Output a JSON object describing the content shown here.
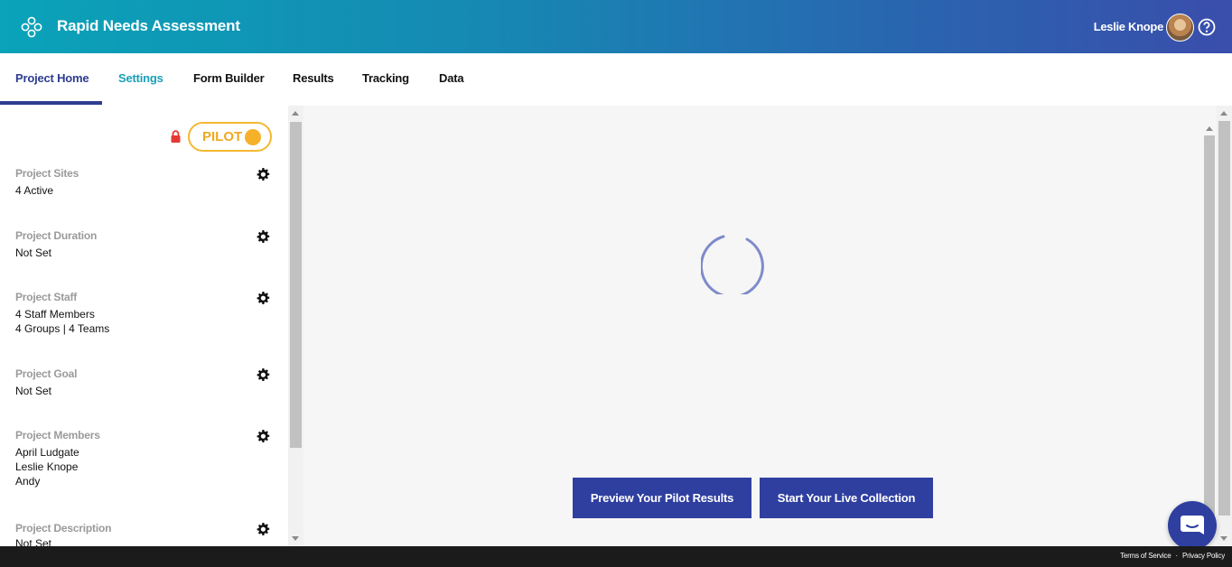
{
  "header": {
    "app_title": "Rapid Needs Assessment",
    "user_name": "Leslie Knope"
  },
  "tabs": [
    {
      "label": "Project Home",
      "active": true
    },
    {
      "label": "Settings",
      "active": false
    },
    {
      "label": "Form Builder",
      "active": false
    },
    {
      "label": "Results",
      "active": false
    },
    {
      "label": "Tracking",
      "active": false
    },
    {
      "label": "Data",
      "active": false
    }
  ],
  "status": {
    "badge_label": "PILOT",
    "locked": true
  },
  "sections": [
    {
      "label": "Project Sites",
      "values": [
        "4 Active"
      ]
    },
    {
      "label": "Project Duration",
      "values": [
        "Not Set"
      ]
    },
    {
      "label": "Project Staff",
      "values": [
        "4 Staff Members",
        "4 Groups | 4 Teams"
      ]
    },
    {
      "label": "Project Goal",
      "values": [
        "Not Set"
      ]
    },
    {
      "label": "Project Members",
      "values": [
        "April Ludgate",
        "Leslie Knope",
        "Andy"
      ]
    },
    {
      "label": "Project Description",
      "values": [
        "Not Set"
      ]
    }
  ],
  "actions": {
    "preview_label": "Preview Your Pilot Results",
    "live_label": "Start Your Live Collection"
  },
  "footer": {
    "terms": "Terms of Service",
    "privacy": "Privacy Policy"
  },
  "colors": {
    "primary": "#2f3fa0",
    "accent_teal": "#1b9fb5",
    "pilot": "#f5b731",
    "lock": "#e53935"
  }
}
